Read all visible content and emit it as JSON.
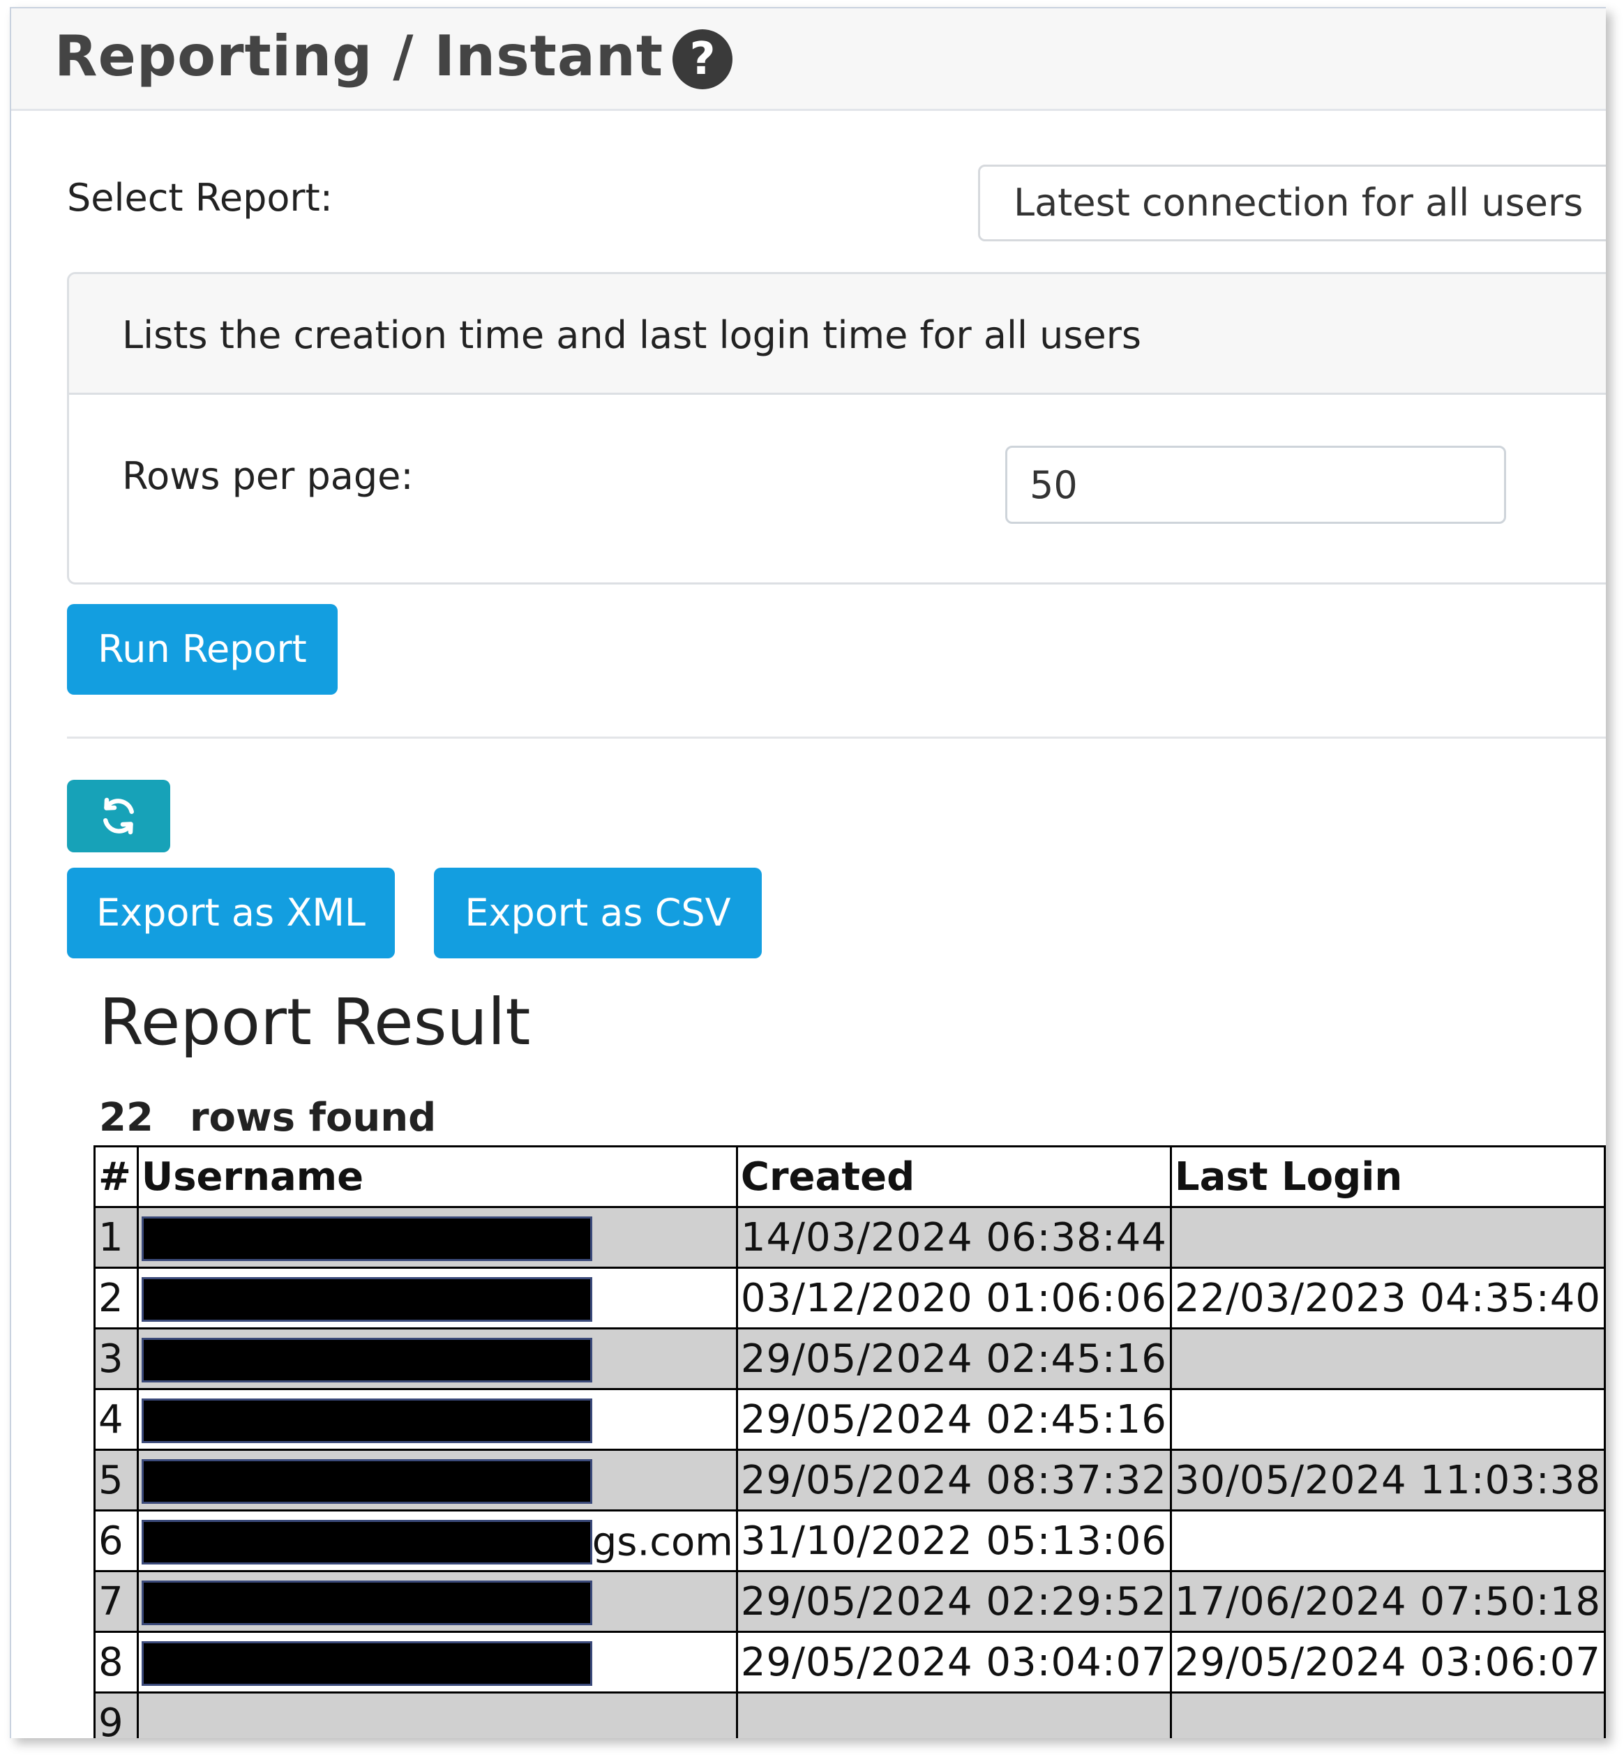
{
  "header": {
    "title": "Reporting / Instant",
    "help_glyph": "?"
  },
  "report_select": {
    "label": "Select Report:",
    "selected": "Latest connection for all users"
  },
  "description_panel": {
    "description": "Lists the creation time and last login time for all users",
    "rows_per_page_label": "Rows per page:",
    "rows_per_page_value": "50"
  },
  "buttons": {
    "run_report": "Run Report",
    "refresh_icon": "refresh-icon",
    "export_xml": "Export as XML",
    "export_csv": "Export as CSV"
  },
  "colors": {
    "primary_button": "#139ee0",
    "refresh_button": "#17a2b8",
    "odd_row": "#d0d0d0"
  },
  "result": {
    "title": "Report Result",
    "row_count": "22",
    "rows_found_label": "rows found",
    "columns": [
      "#",
      "Username",
      "Created",
      "Last Login"
    ],
    "rows": [
      {
        "num": "1",
        "username_visible": "",
        "created": "14/03/2024 06:38:44",
        "last_login": ""
      },
      {
        "num": "2",
        "username_visible": "",
        "created": "03/12/2020 01:06:06",
        "last_login": "22/03/2023 04:35:40"
      },
      {
        "num": "3",
        "username_visible": "",
        "created": "29/05/2024 02:45:16",
        "last_login": ""
      },
      {
        "num": "4",
        "username_visible": "",
        "created": "29/05/2024 02:45:16",
        "last_login": ""
      },
      {
        "num": "5",
        "username_visible": "",
        "created": "29/05/2024 08:37:32",
        "last_login": "30/05/2024 11:03:38"
      },
      {
        "num": "6",
        "username_visible": "gs.com",
        "created": "31/10/2022 05:13:06",
        "last_login": ""
      },
      {
        "num": "7",
        "username_visible": "",
        "created": "29/05/2024 02:29:52",
        "last_login": "17/06/2024 07:50:18"
      },
      {
        "num": "8",
        "username_visible": "",
        "created": "29/05/2024 03:04:07",
        "last_login": "29/05/2024 03:06:07"
      },
      {
        "num": "9",
        "username_visible": "",
        "created": "",
        "last_login": ""
      }
    ]
  }
}
